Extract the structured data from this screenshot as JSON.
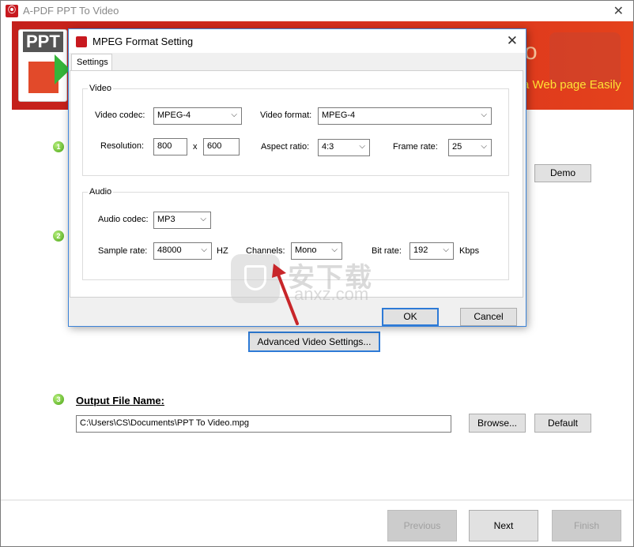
{
  "app": {
    "title": "A-PDF PPT To Video"
  },
  "banner": {
    "title_fragment": "o",
    "slogan_fragment": "a Web page Easily",
    "ppt_label": "PPT"
  },
  "steps": {
    "s1": "1",
    "s2": "2",
    "s3": "3"
  },
  "output": {
    "label": "Output File Name:",
    "path": "C:\\Users\\CS\\Documents\\PPT To Video.mpg"
  },
  "buttons": {
    "demo": "Demo",
    "advanced": "Advanced Video Settings...",
    "browse": "Browse...",
    "default": "Default",
    "previous": "Previous",
    "next": "Next",
    "finish": "Finish"
  },
  "dialog": {
    "title": "MPEG Format Setting",
    "tab": "Settings",
    "video": {
      "group_title": "Video",
      "codec_label": "Video codec:",
      "codec_value": "MPEG-4",
      "format_label": "Video format:",
      "format_value": "MPEG-4",
      "resolution_label": "Resolution:",
      "width": "800",
      "x_sep": "x",
      "height": "600",
      "aspect_label": "Aspect ratio:",
      "aspect_value": "4:3",
      "frame_label": "Frame rate:",
      "frame_value": "25"
    },
    "audio": {
      "group_title": "Audio",
      "codec_label": "Audio codec:",
      "codec_value": "MP3",
      "sample_label": "Sample rate:",
      "sample_value": "48000",
      "hz": "HZ",
      "channels_label": "Channels:",
      "channels_value": "Mono",
      "bitrate_label": "Bit rate:",
      "bitrate_value": "192",
      "kbps": "Kbps"
    },
    "ok": "OK",
    "cancel": "Cancel"
  },
  "watermark": {
    "cn": "安下载",
    "en": "anxz.com"
  }
}
